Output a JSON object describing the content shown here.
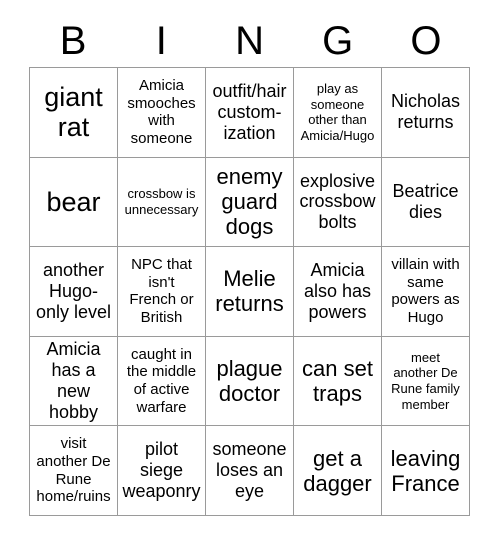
{
  "card": {
    "title": "BINGO",
    "header_letters": [
      "B",
      "I",
      "N",
      "G",
      "O"
    ],
    "border_color": "#9a9a9a",
    "background_color": "#ffffff",
    "text_color": "#000000",
    "rows": 5,
    "columns": 5
  },
  "cells": [
    [
      {
        "text": "giant\nrat",
        "size": "xl"
      },
      {
        "text": "Amicia\nsmooches\nwith\nsomeone",
        "size": "sm"
      },
      {
        "text": "outfit/hair\ncustom-\nization",
        "size": "md"
      },
      {
        "text": "play as\nsomeone\nother than\nAmicia/Hugo",
        "size": "xs"
      },
      {
        "text": "Nicholas\nreturns",
        "size": "md"
      }
    ],
    [
      {
        "text": "bear",
        "size": "xl"
      },
      {
        "text": "crossbow is\nunnecessary",
        "size": "xs"
      },
      {
        "text": "enemy\nguard\ndogs",
        "size": "lg"
      },
      {
        "text": "explosive\ncrossbow\nbolts",
        "size": "md"
      },
      {
        "text": "Beatrice\ndies",
        "size": "md"
      }
    ],
    [
      {
        "text": "another\nHugo-\nonly level",
        "size": "md"
      },
      {
        "text": "NPC that\nisn't\nFrench or\nBritish",
        "size": "sm"
      },
      {
        "text": "Melie\nreturns",
        "size": "lg"
      },
      {
        "text": "Amicia\nalso has\npowers",
        "size": "md"
      },
      {
        "text": "villain with\nsame\npowers as\nHugo",
        "size": "sm"
      }
    ],
    [
      {
        "text": "Amicia\nhas a new\nhobby",
        "size": "md"
      },
      {
        "text": "caught in\nthe middle\nof active\nwarfare",
        "size": "sm"
      },
      {
        "text": "plague\ndoctor",
        "size": "lg"
      },
      {
        "text": "can set\ntraps",
        "size": "lg"
      },
      {
        "text": "meet\nanother De\nRune family\nmember",
        "size": "xs"
      }
    ],
    [
      {
        "text": "visit\nanother De\nRune\nhome/ruins",
        "size": "sm"
      },
      {
        "text": "pilot\nsiege\nweaponry",
        "size": "md"
      },
      {
        "text": "someone\nloses an\neye",
        "size": "md"
      },
      {
        "text": "get a\ndagger",
        "size": "lg"
      },
      {
        "text": "leaving\nFrance",
        "size": "lg"
      }
    ]
  ]
}
